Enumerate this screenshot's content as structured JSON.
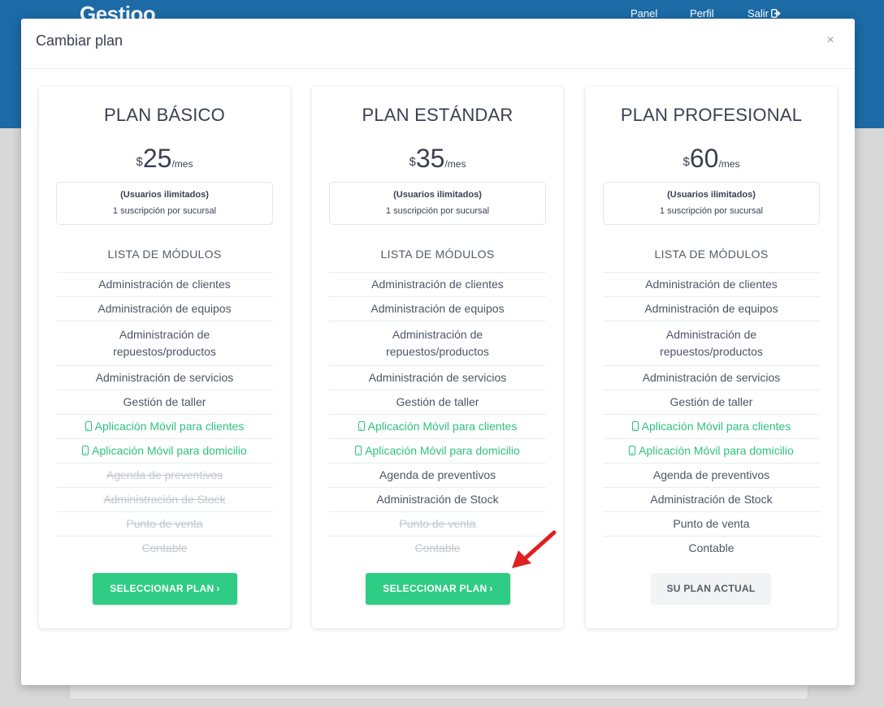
{
  "app": {
    "logo": "Gestioo",
    "nav": {
      "panel": "Panel",
      "perfil": "Perfil",
      "salir": "Salir"
    }
  },
  "modal": {
    "title": "Cambiar plan",
    "close": "×"
  },
  "plans": [
    {
      "name": "PLAN BÁSICO",
      "currency": "$",
      "amount": "25",
      "period": "/mes",
      "info_title": "(Usuarios ilimitados)",
      "info_sub": "1 suscripción por sucursal",
      "modules_title": "LISTA DE MÓDULOS",
      "modules": [
        "Administración de clientes",
        "Administración de equipos",
        "Administración de repuestos/productos",
        "Administración de servicios",
        "Gestión de taller",
        "Aplicación Móvil para clientes",
        "Aplicación Móvil para domicilio",
        "Agenda de preventivos",
        "Administración de Stock",
        "Punto de venta",
        "Contable"
      ],
      "button": "SELECCIONAR PLAN"
    },
    {
      "name": "PLAN ESTÁNDAR",
      "currency": "$",
      "amount": "35",
      "period": "/mes",
      "info_title": "(Usuarios ilimitados)",
      "info_sub": "1 suscripción por sucursal",
      "modules_title": "LISTA DE MÓDULOS",
      "modules": [
        "Administración de clientes",
        "Administración de equipos",
        "Administración de repuestos/productos",
        "Administración de servicios",
        "Gestión de taller",
        "Aplicación Móvil para clientes",
        "Aplicación Móvil para domicilio",
        "Agenda de preventivos",
        "Administración de Stock",
        "Punto de venta",
        "Contable"
      ],
      "button": "SELECCIONAR PLAN"
    },
    {
      "name": "PLAN PROFESIONAL",
      "currency": "$",
      "amount": "60",
      "period": "/mes",
      "info_title": "(Usuarios ilimitados)",
      "info_sub": "1 suscripción por sucursal",
      "modules_title": "LISTA DE MÓDULOS",
      "modules": [
        "Administración de clientes",
        "Administración de equipos",
        "Administración de repuestos/productos",
        "Administración de servicios",
        "Gestión de taller",
        "Aplicación Móvil para clientes",
        "Aplicación Móvil para domicilio",
        "Agenda de preventivos",
        "Administración de Stock",
        "Punto de venta",
        "Contable"
      ],
      "button": "SU PLAN ACTUAL"
    }
  ],
  "colors": {
    "header_blue": "#1c6aa6",
    "accent_green": "#2ecc85",
    "mobile_green": "#2ec27e",
    "disabled_gray": "#c4c7cc",
    "annotation_red": "#e02020"
  },
  "icons": {
    "mobile": "mobile-phone-icon",
    "chevron": "chevron-right-icon",
    "exit": "sign-out-icon",
    "close": "close-icon"
  }
}
